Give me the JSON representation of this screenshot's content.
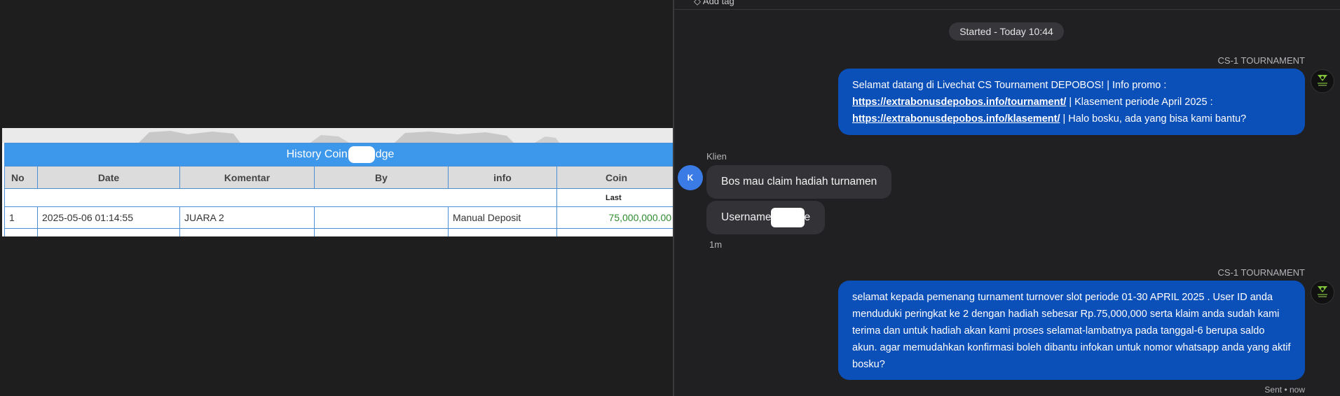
{
  "left_panel": {
    "table_title_left": "History Coin",
    "table_title_right": "dge",
    "columns": [
      "No",
      "Date",
      "Komentar",
      "By",
      "info",
      "Coin"
    ],
    "sub_header_label": "Last",
    "rows": [
      {
        "no": "1",
        "date": "2025-05-06 01:14:55",
        "komentar": "JUARA 2",
        "by": "",
        "info": "Manual Deposit",
        "coin": "75,000,000.00"
      }
    ]
  },
  "chat": {
    "top_bar_text": "◇ Add tag",
    "started_label": "Started - Today 10:44",
    "messages": [
      {
        "sender": "CS-1 TOURNAMENT",
        "line1": "Selamat datang di Livechat CS Tournament DEPOBOS! | Info promo :",
        "link1": "https://extrabonusdepobos.info/tournament/",
        "line2_after_link": " | Klasement periode April 2025 :",
        "link2": "https://extrabonusdepobos.info/klasement/",
        "line3_after_link": " | Halo bosku, ada yang bisa kami bantu?"
      },
      {
        "sender": "Klien",
        "avatar_letter": "K",
        "bubble1": "Bos mau claim hadiah turnamen",
        "bubble2_left": "Username",
        "bubble2_right": "e",
        "time": "1m"
      },
      {
        "sender": "CS-1 TOURNAMENT",
        "text": "selamat kepada pemenang turnament turnover slot periode 01-30 APRIL 2025 . User ID anda menduduki peringkat ke 2 dengan hadiah sebesar Rp.75,000,000 serta klaim anda sudah kami terima dan untuk hadiah akan kami proses selamat-lambatnya pada tanggal-6 berupa saldo akun. agar memudahkan konfirmasi boleh dibantu infokan untuk nomor whatsapp anda yang aktif bosku?",
        "status": "Sent • now"
      }
    ]
  },
  "colors": {
    "agent_bubble": "#0b4fb8",
    "client_bubble": "#333337",
    "table_header": "#3d97ea",
    "money_green": "#2e8b2e",
    "client_avatar": "#3b7be6"
  }
}
